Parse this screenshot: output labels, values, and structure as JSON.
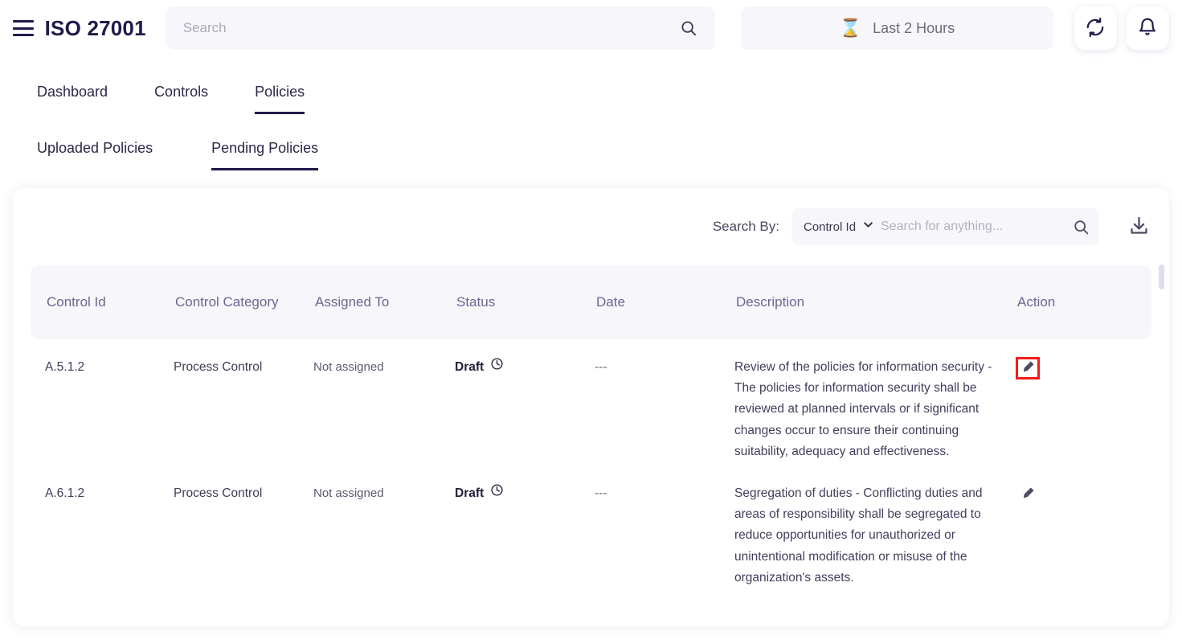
{
  "header": {
    "menu_icon": "hamburger-menu-icon",
    "title": "ISO 27001",
    "search": {
      "placeholder": "Search",
      "value": "",
      "icon": "search-icon"
    },
    "daterange": {
      "icon": "hourglass-icon",
      "label": "Last 2 Hours"
    },
    "refresh_icon": "refresh-icon",
    "notifications_icon": "bell-icon"
  },
  "primary_tabs": [
    {
      "label": "Dashboard",
      "active": false
    },
    {
      "label": "Controls",
      "active": false
    },
    {
      "label": "Policies",
      "active": true
    }
  ],
  "secondary_tabs": [
    {
      "label": "Uploaded Policies",
      "active": false
    },
    {
      "label": "Pending Policies",
      "active": true
    }
  ],
  "toolbar": {
    "search_by_label": "Search By:",
    "dropdown_value": "Control Id",
    "dropdown_icon": "chevron-down-icon",
    "search_placeholder": "Search for anything...",
    "search_value": "",
    "search_icon": "search-icon",
    "download_icon": "download-icon"
  },
  "table": {
    "columns": [
      "Control Id",
      "Control Category",
      "Assigned To",
      "Status",
      "Date",
      "Description",
      "Action"
    ],
    "rows": [
      {
        "control_id": "A.5.1.2",
        "control_category": "Process Control",
        "assigned_to": "Not assigned",
        "status": "Draft",
        "status_icon": "clock-icon",
        "date": "---",
        "description": "Review of the policies for information security - The policies for information security shall be reviewed at planned intervals or if significant changes occur to ensure their continuing suitability, adequacy and effectiveness.",
        "action_icon": "edit-pencil-icon",
        "action_highlighted": true
      },
      {
        "control_id": "A.6.1.2",
        "control_category": "Process Control",
        "assigned_to": "Not assigned",
        "status": "Draft",
        "status_icon": "clock-icon",
        "date": "---",
        "description": "Segregation of duties - Conflicting duties and areas of responsibility shall be segregated to reduce opportunities for unauthorized or unintentional modification or misuse of the organization's assets.",
        "action_icon": "edit-pencil-icon",
        "action_highlighted": false
      }
    ]
  },
  "colors": {
    "brand": "#1e1b4b",
    "header_text": "#6a6790",
    "highlight": "#f41b1b",
    "panel_bg": "#f7f7fb"
  }
}
